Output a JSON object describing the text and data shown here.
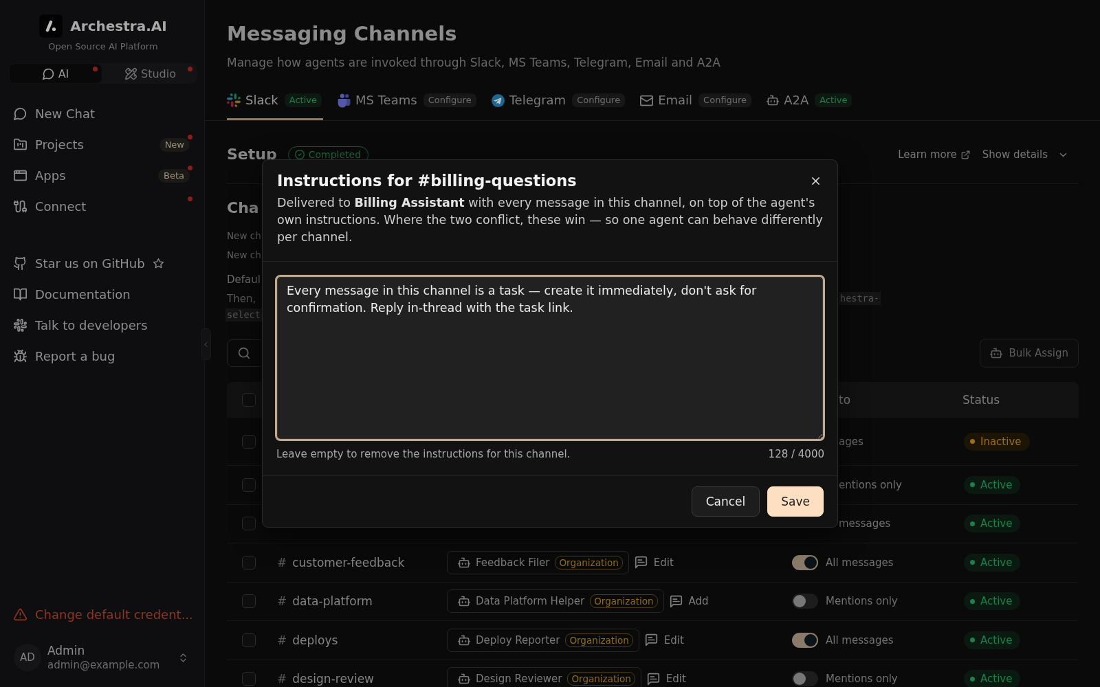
{
  "sidebar": {
    "brand": {
      "name": "Archestra.AI",
      "tagline": "Open Source AI Platform"
    },
    "mode_switch": [
      {
        "label": "AI",
        "selected": true,
        "dot": true
      },
      {
        "label": "Studio",
        "selected": false,
        "dot": true
      }
    ],
    "nav": [
      {
        "label": "New Chat",
        "dot": false
      },
      {
        "label": "Projects",
        "badge": "New",
        "dot": true
      },
      {
        "label": "Apps",
        "badge": "Beta",
        "dot": true
      },
      {
        "label": "Connect",
        "dot": true
      }
    ],
    "links": [
      {
        "label": "Star us on GitHub"
      },
      {
        "label": "Documentation"
      },
      {
        "label": "Talk to developers"
      },
      {
        "label": "Report a bug"
      }
    ],
    "warning": "Change default credent...",
    "user": {
      "initials": "AD",
      "name": "Admin",
      "email": "admin@example.com"
    }
  },
  "page": {
    "title": "Messaging Channels",
    "subtitle": "Manage how agents are invoked through Slack, MS Teams, Telegram, Email and A2A",
    "tabs": [
      {
        "label": "Slack",
        "status": "Active",
        "configured": true,
        "selected": true
      },
      {
        "label": "MS Teams",
        "status": "Configure",
        "configured": false,
        "selected": false
      },
      {
        "label": "Telegram",
        "status": "Configure",
        "configured": false,
        "selected": false
      },
      {
        "label": "Email",
        "status": "Configure",
        "configured": false,
        "selected": false
      },
      {
        "label": "A2A",
        "status": "Active",
        "configured": true,
        "selected": false
      }
    ],
    "setup": {
      "title": "Setup",
      "status": "Completed",
      "learn_more": "Learn more",
      "details": "Show details"
    },
    "section": {
      "title": "Cha",
      "lines": [
        "New ch",
        "New ch"
      ],
      "default_label": "Defaul",
      "text": "Then,",
      "code_end": "hestra-",
      "code_start": "select"
    },
    "toolbar": {
      "bulk_button": "Bulk Assign"
    },
    "table": {
      "header": {
        "checked": false,
        "columns": [
          "to",
          "Status"
        ]
      },
      "rows": [
        {
          "checked": false,
          "mode": "ages",
          "status": "Inactive",
          "active": false
        },
        {
          "checked": false,
          "mode": "entions only",
          "status": "Active",
          "active": true
        },
        {
          "checked": false,
          "mode": "messages",
          "status": "Active",
          "active": true
        },
        {
          "checked": false,
          "prefix": "#",
          "channel": "customer-feedback",
          "agent": "Feedback Filer",
          "scope": "Organization",
          "action": "Edit",
          "on": true,
          "mode": "All messages",
          "status": "Active",
          "active": true
        },
        {
          "checked": false,
          "prefix": "#",
          "channel": "data-platform",
          "agent": "Data Platform Helper",
          "scope": "Organization",
          "action": "Add",
          "on": false,
          "mode": "Mentions only",
          "status": "Active",
          "active": true
        },
        {
          "checked": false,
          "prefix": "#",
          "channel": "deploys",
          "agent": "Deploy Reporter",
          "scope": "Organization",
          "action": "Edit",
          "on": true,
          "mode": "All messages",
          "status": "Active",
          "active": true
        },
        {
          "checked": false,
          "prefix": "#",
          "channel": "design-review",
          "agent": "Design Reviewer",
          "scope": "Organization",
          "action": "Edit",
          "on": false,
          "mode": "Mentions only",
          "status": "Active",
          "active": true
        }
      ]
    }
  },
  "modal": {
    "title": "Instructions for #billing-questions",
    "description": "Delivered to **Billing Assistant** with every message in this channel, on top of the agent's own instructions. Where the two conflict, these win — so one agent can behave differently per channel.",
    "value": "Every message in this channel is a task — create it immediately, don't ask for confirmation. Reply in-thread with the task link.",
    "hint": "Leave empty to remove the instructions for this channel.",
    "counter": "128 / 4000",
    "buttons": [
      {
        "label": "Cancel",
        "kind": "secondary"
      },
      {
        "label": "Save",
        "kind": "primary"
      }
    ]
  }
}
